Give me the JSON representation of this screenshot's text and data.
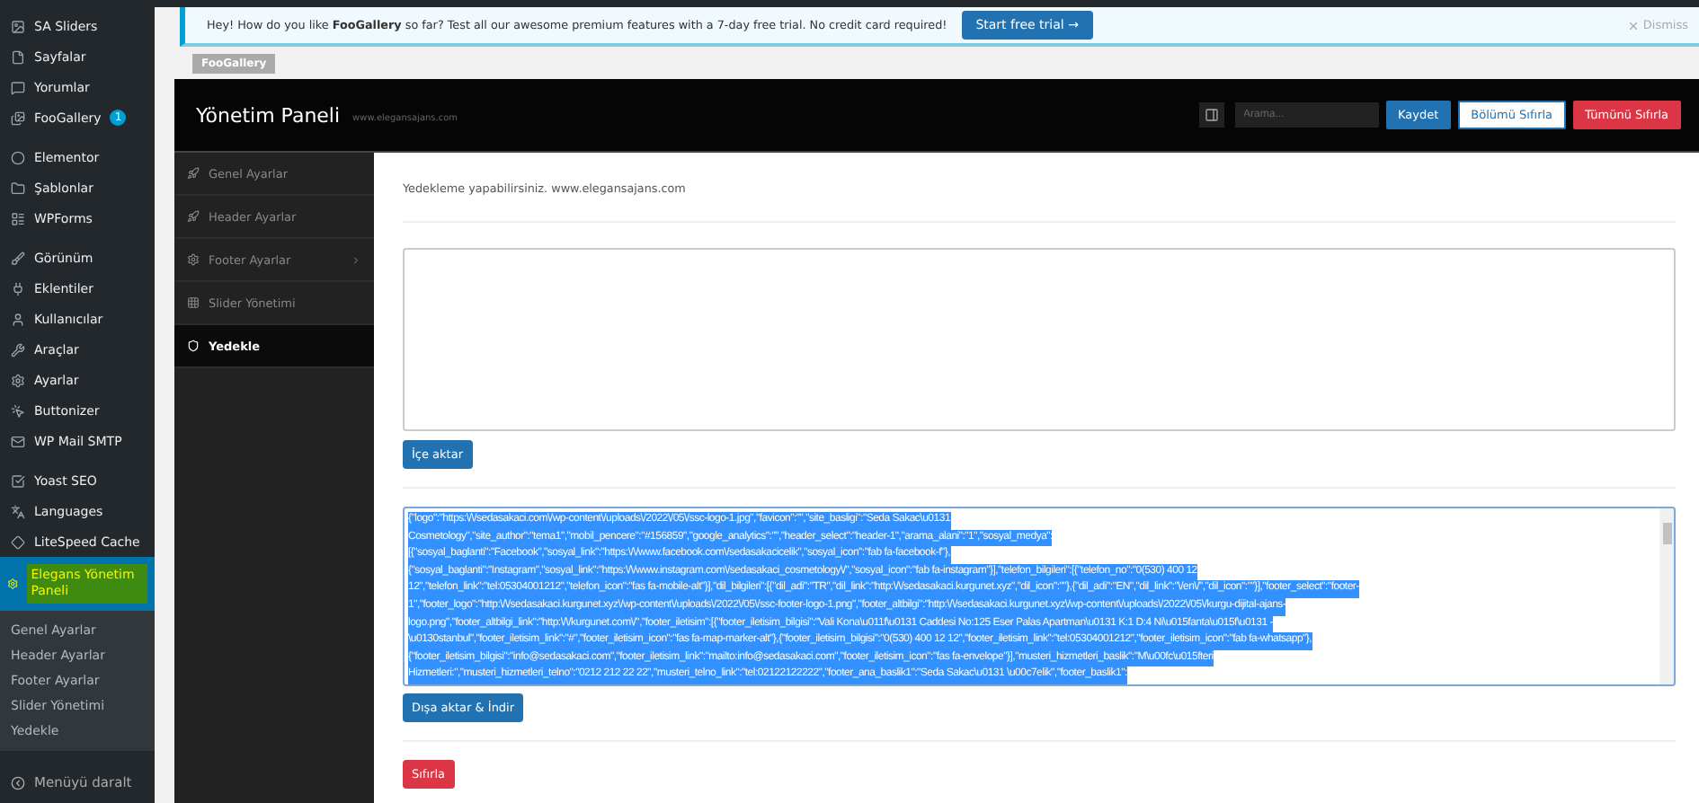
{
  "admin_menu": {
    "groups": [
      {
        "items": [
          {
            "label": "SA Sliders",
            "selected": false
          },
          {
            "label": "Sayfalar",
            "selected": false
          },
          {
            "label": "Yorumlar",
            "selected": false
          },
          {
            "label": "FooGallery",
            "badge": "1",
            "selected": false
          }
        ]
      },
      {
        "items": [
          {
            "label": "Elementor",
            "selected": false
          },
          {
            "label": "Şablonlar",
            "selected": false
          },
          {
            "label": "WPForms",
            "selected": false
          }
        ]
      },
      {
        "items": [
          {
            "label": "Görünüm",
            "selected": false
          },
          {
            "label": "Eklentiler",
            "selected": false
          },
          {
            "label": "Kullanıcılar",
            "selected": false
          },
          {
            "label": "Araçlar",
            "selected": false
          },
          {
            "label": "Ayarlar",
            "selected": false
          },
          {
            "label": "Buttonizer",
            "selected": false
          },
          {
            "label": "WP Mail SMTP",
            "selected": false
          }
        ]
      },
      {
        "items": [
          {
            "label": "Yoast SEO",
            "selected": false
          },
          {
            "label": "Languages",
            "selected": false
          },
          {
            "label": "LiteSpeed Cache",
            "selected": false
          },
          {
            "label": "Elegans Yönetim Paneli",
            "selected": true,
            "submenu": [
              "Genel Ayarlar",
              "Header Ayarlar",
              "Footer Ayarlar",
              "Slider Yönetimi",
              "Yedekle"
            ]
          }
        ]
      }
    ],
    "collapse": "Menüyü daralt"
  },
  "notice": {
    "text": "Hey! How do you like **FooGallery** so far? Test all our awesome premium features with a 7-day free trial. No credit card required!",
    "button": "Start free trial →",
    "dismiss": "Dismiss"
  },
  "plugin_tag": "FooGallery",
  "panel": {
    "title": "Yönetim Paneli",
    "subtitle": "www.elegansajans.com",
    "search": {
      "placeholder": "Arama..."
    },
    "actions": [
      {
        "label": "Kaydet",
        "kind": "primary"
      },
      {
        "label": "Bölümü Sıfırla",
        "kind": "secondary"
      },
      {
        "label": "Tümünü Sıfırla",
        "kind": "danger"
      }
    ],
    "nav": [
      {
        "label": "Genel Ayarlar",
        "selected": false,
        "expandable": false
      },
      {
        "label": "Header Ayarlar",
        "selected": false,
        "expandable": false
      },
      {
        "label": "Footer Ayarlar",
        "selected": false,
        "expandable": true
      },
      {
        "label": "Slider Yönetimi",
        "selected": false,
        "expandable": false
      },
      {
        "label": "Yedekle",
        "selected": true,
        "expandable": false
      }
    ],
    "intro": "Yedekleme yapabilirsiniz. www.elegansajans.com",
    "import_button": "İçe aktar",
    "export_lines": [
      "{\"logo\":\"https:\\/\\/sedasakaci.com\\/wp-content\\/uploads\\/2022\\/05\\/ssc-logo-1.jpg\",\"favicon\":\"\",\"site_basligi\":\"Seda Sakac\\u0131",
      "Cosmetology\",\"site_author\":\"tema1\",\"mobil_pencere\":\"#156859\",\"google_analytics\":\"\",\"header_select\":\"header-1\",\"arama_alani\":\"1\",\"sosyal_medya\":",
      "[{\"sosyal_baglanti\":\"Facebook\",\"sosyal_link\":\"https:\\/\\/www.facebook.com\\/sedasakacicelik\",\"sosyal_icon\":\"fab fa-facebook-f\"},",
      "{\"sosyal_baglanti\":\"Instagram\",\"sosyal_link\":\"https:\\/\\/www.instagram.com\\/sedasakaci_cosmetology\\/\",\"sosyal_icon\":\"fab fa-instagram\"}],\"telefon_bilgileri\":[{\"telefon_no\":\"0(530) 400 12",
      "12\",\"telefon_link\":\"tel:05304001212\",\"telefon_icon\":\"fas fa-mobile-alt\"}],\"dil_bilgileri\":[{\"dil_adi\":\"TR\",\"dil_link\":\"http:\\/\\/sedasakaci.kurgunet.xyz\",\"dil_icon\":\"\"},{\"dil_adi\":\"EN\",\"dil_link\":\"\\/en\\/\",\"dil_icon\":\"\"}],\"footer_select\":\"footer-",
      "1\",\"footer_logo\":\"http:\\/\\/sedasakaci.kurgunet.xyz\\/wp-content\\/uploads\\/2022\\/05\\/ssc-footer-logo-1.png\",\"footer_altbilgi\":\"http:\\/\\/sedasakaci.kurgunet.xyz\\/wp-content\\/uploads\\/2022\\/05\\/kurgu-dijital-ajans-",
      "logo.png\",\"footer_altbilgi_link\":\"http:\\/\\/kurgunet.com\\/\",\"footer_iletisim\":[{\"footer_iletisim_bilgisi\":\"Vali Kona\\u011f\\u0131 Caddesi No:125 Eser Palas Apartman\\u0131 K:1 D:4 Ni\\u015fanta\\u015f\\u0131 -",
      "\\u0130stanbul\",\"footer_iletisim_link\":\"#\",\"footer_iletisim_icon\":\"fas fa-map-marker-alt\"},{\"footer_iletisim_bilgisi\":\"0(530) 400 12 12\",\"footer_iletisim_link\":\"tel:05304001212\",\"footer_iletisim_icon\":\"fab fa-whatsapp\"},",
      "{\"footer_iletisim_bilgisi\":\"info@sedasakaci.com\",\"footer_iletisim_link\":\"mailto:info@sedasakaci.com\",\"footer_iletisim_icon\":\"fas fa-envelope\"}],\"musteri_hizmetleri_baslik\":\"M\\u00fc\\u015fteri",
      "Hizmetleri:\",\"musteri_hizmetleri_telno\":\"0212 212 22 22\",\"musteri_telno_link\":\"tel:02122122222\",\"footer_ana_baslik1\":\"Seda Sakac\\u0131 \\u00c7elik\",\"footer_baslik1\":"
    ],
    "export_button": "Dışa aktar & İndir",
    "reset_button": "Sıfırla"
  }
}
